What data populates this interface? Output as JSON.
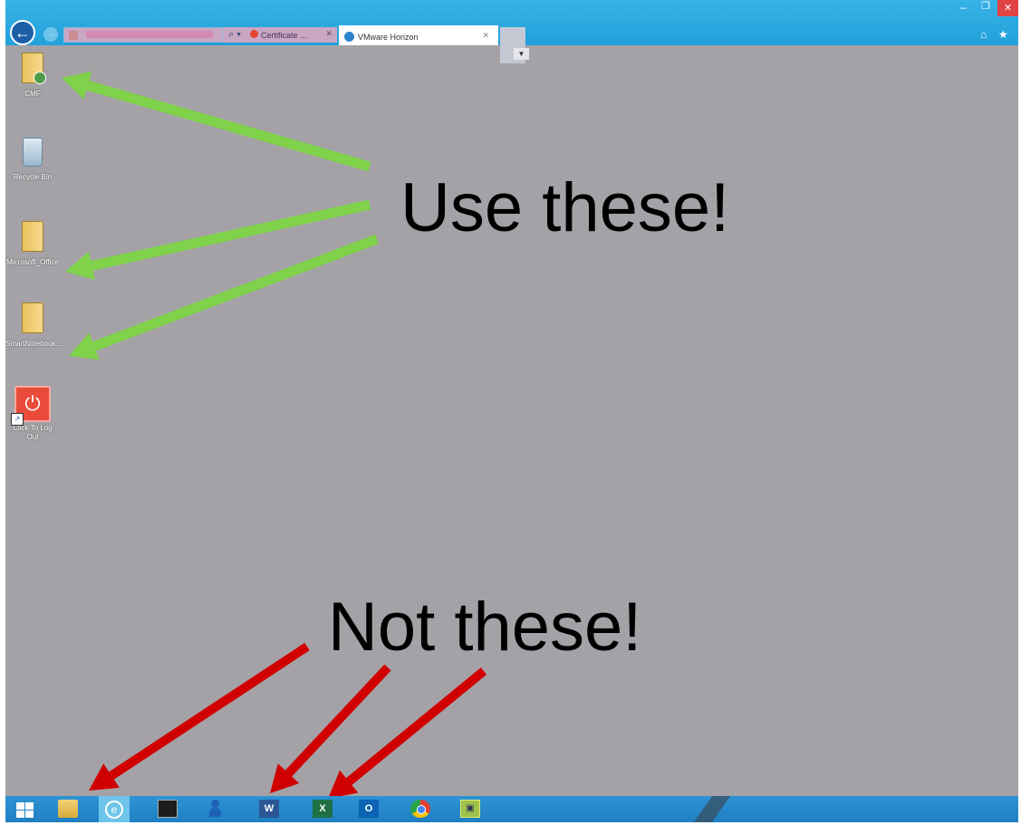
{
  "browser": {
    "back_icon": "back-arrow-icon",
    "forward_icon": "forward-arrow-icon",
    "search_glyph": "⌕ ▾",
    "tabs": [
      {
        "label": "Certificate ...",
        "close": "✕",
        "icon": "certificate-error-icon"
      },
      {
        "label": "VMware Horizon",
        "close": "✕",
        "icon": "ie-icon"
      }
    ],
    "tab_dropdown": "▼",
    "window_controls": {
      "minimize": "–",
      "maximize": "❐",
      "close": "✕"
    },
    "home_glyph": "⌂",
    "favorites_glyph": "★"
  },
  "desktop": {
    "background_color": "#a4a2a6",
    "icons": [
      {
        "label": "CMF",
        "type": "folder"
      },
      {
        "label": "Recycle Bin",
        "type": "recycle-bin"
      },
      {
        "label": "Microsoft_Office",
        "type": "folder"
      },
      {
        "label": "SmartNotebook...",
        "type": "folder"
      },
      {
        "label": "Click To Log Out",
        "type": "logout-shortcut",
        "glyph": "⏻"
      }
    ]
  },
  "annotations": {
    "use_these": "Use these!",
    "not_these": "Not these!",
    "green_arrow_color": "#7fd24a",
    "red_arrow_color": "#d00000"
  },
  "taskbar": {
    "color": "#1f7fc2",
    "items": [
      {
        "name": "start",
        "icon": "windows-logo-icon"
      },
      {
        "name": "file-explorer",
        "icon": "folder-icon"
      },
      {
        "name": "internet-explorer",
        "icon": "ie-icon",
        "glyph": "e",
        "active": true
      },
      {
        "name": "command-prompt",
        "icon": "terminal-icon"
      },
      {
        "name": "user-accounts",
        "icon": "user-icon"
      },
      {
        "name": "word",
        "icon": "word-icon",
        "glyph": "W"
      },
      {
        "name": "excel",
        "icon": "excel-icon",
        "glyph": "X"
      },
      {
        "name": "outlook",
        "icon": "outlook-icon",
        "glyph": "O"
      },
      {
        "name": "chrome",
        "icon": "chrome-icon"
      },
      {
        "name": "other-app",
        "icon": "app-icon",
        "glyph": "▣"
      }
    ]
  }
}
